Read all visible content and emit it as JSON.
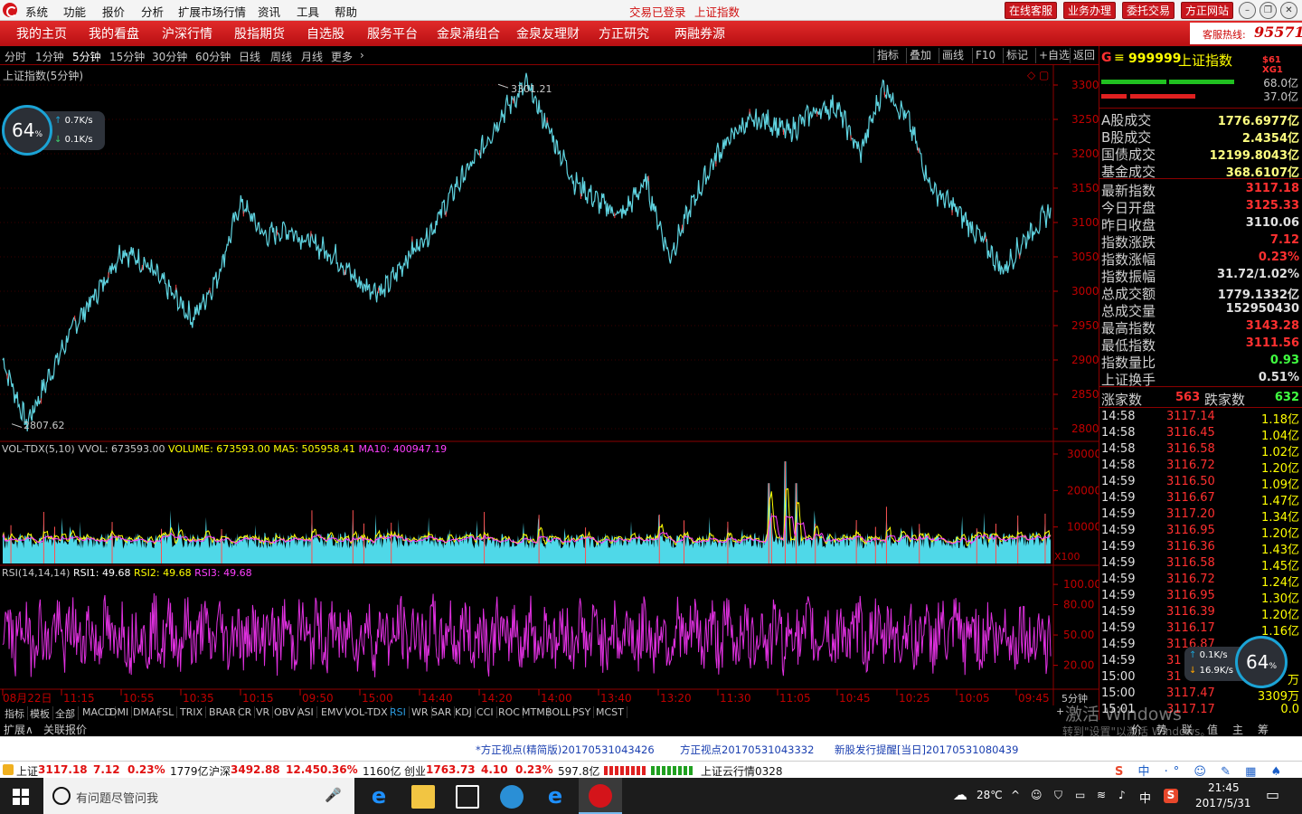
{
  "menu": {
    "items": [
      "系统",
      "功能",
      "报价",
      "分析",
      "扩展市场行情",
      "资讯",
      "工具",
      "帮助"
    ],
    "center": [
      "交易已登录",
      "上证指数"
    ],
    "buttons": [
      "在线客服",
      "业务办理",
      "委托交易",
      "方正网站"
    ]
  },
  "nav": {
    "items": [
      "我的主页",
      "我的看盘",
      "沪深行情",
      "股指期货",
      "自选股",
      "服务平台",
      "金泉涌组合",
      "金泉友理财",
      "方正研究",
      "两融券源"
    ],
    "hotline_label": "客服热线:",
    "hotline_num": "95571"
  },
  "periods": {
    "items": [
      "分时",
      "1分钟",
      "5分钟",
      "15分钟",
      "30分钟",
      "60分钟",
      "日线",
      "周线",
      "月线",
      "更多"
    ],
    "active": 2
  },
  "toolbar": {
    "items": [
      "指标",
      "叠加",
      "画线",
      "F10",
      "标记",
      "+自选",
      "返回"
    ]
  },
  "chart": {
    "title": "上证指数(5分钟)",
    "high_label": "3301.21",
    "low_label": "2807.62",
    "vol_header": {
      "name": "VOL-TDX(5,10)",
      "vvol": "VVOL: 673593.00",
      "volume": "VOLUME: 673593.00",
      "ma5": "MA5: 505958.41",
      "ma10": "MA10: 400947.19"
    },
    "vol_unit": "X100",
    "rsi_header": {
      "name": "RSI(14,14,14)",
      "rsi1": "RSI1: 49.68",
      "rsi2": "RSI2: 49.68",
      "rsi3": "RSI3: 49.68"
    },
    "x_labels": [
      "08月22日",
      "11:15",
      "10:55",
      "10:35",
      "10:15",
      "09:50",
      "15:00",
      "14:40",
      "14:20",
      "14:00",
      "13:40",
      "13:20",
      "11:30",
      "11:05",
      "10:45",
      "10:25",
      "10:05",
      "09:45"
    ],
    "x_unit": "5分钟",
    "colors": {
      "price": "#5fd3e0",
      "price_up": "#ff4040",
      "vol": "#4fd8e8",
      "ma5": "#ffff00",
      "ma10": "#ff40ff",
      "rsi": "#e030e0",
      "grid": "#8b0000",
      "axis": "#c00000"
    }
  },
  "chart_data": {
    "type": "line",
    "title": "上证指数(5分钟)",
    "ylim": [
      2800,
      3300
    ],
    "yticks": [
      3300,
      3250,
      3200,
      3150,
      3100,
      3050,
      3000,
      2950,
      2900,
      2850,
      2800
    ],
    "x": [
      "08月22日",
      "11:15",
      "10:55",
      "10:35",
      "10:15",
      "09:50",
      "15:00",
      "14:40",
      "14:20",
      "14:00",
      "13:40",
      "13:20",
      "11:30",
      "11:05",
      "10:45",
      "10:25",
      "10:05",
      "09:45"
    ],
    "series": [
      {
        "values": [
          2900,
          2807,
          2880,
          2950,
          3000,
          3060,
          3040,
          3000,
          2960,
          3020,
          3130,
          3080,
          3090,
          3070,
          3050,
          3010,
          3000,
          3050,
          3090,
          3150,
          3200,
          3260,
          3301,
          3230,
          3160,
          3130,
          3110,
          3160,
          3050,
          3130,
          3200,
          3240,
          3250,
          3230,
          3260,
          3270,
          3200,
          3300,
          3250,
          3150,
          3120,
          3080,
          3030,
          3080,
          3117
        ]
      }
    ],
    "vol": {
      "ylim": [
        0,
        30000
      ],
      "yticks": [
        30000,
        20000,
        10000
      ]
    },
    "rsi": {
      "ylim": [
        0,
        100
      ],
      "yticks": [
        100.0,
        80.0,
        50.0,
        20.0
      ],
      "last": 49.68
    }
  },
  "speed": {
    "pct": "64",
    "pct_unit": "%",
    "up": "0.7K/s",
    "down": "0.1K/s",
    "up2": "0.1K/s",
    "down2": "16.9K/s"
  },
  "rpanel": {
    "header": {
      "code": "999999",
      "name": "上证指数",
      "tag": "$61 XG1",
      "pct1": "68.0亿",
      "pct2": "37.0亿"
    },
    "volumes": [
      [
        "A股成交",
        "1776.6977亿"
      ],
      [
        "B股成交",
        "2.4354亿"
      ],
      [
        "国债成交",
        "12199.8043亿"
      ],
      [
        "基金成交",
        "368.6107亿"
      ]
    ],
    "stats": [
      [
        "最新指数",
        "3117.18",
        "#ff3030"
      ],
      [
        "今日开盘",
        "3125.33",
        "#ff3030"
      ],
      [
        "昨日收盘",
        "3110.06",
        "#e0e0e0"
      ],
      [
        "指数涨跌",
        "7.12",
        "#ff3030"
      ],
      [
        "指数涨幅",
        "0.23%",
        "#ff3030"
      ],
      [
        "指数振幅",
        "31.72/1.02%",
        "#e0e0e0"
      ],
      [
        "总成交额",
        "1779.1332亿",
        "#e0e0e0"
      ],
      [
        "总成交量",
        "152950430",
        "#e0e0e0"
      ],
      [
        "最高指数",
        "3143.28",
        "#ff3030"
      ],
      [
        "最低指数",
        "3111.56",
        "#ff3030"
      ],
      [
        "指数量比",
        "0.93",
        "#40ff40"
      ],
      [
        "上证换手",
        "0.51%",
        "#e0e0e0"
      ]
    ],
    "updown": {
      "up_label": "涨家数",
      "up": "563",
      "down_label": "跌家数",
      "down": "632"
    },
    "ticks": [
      [
        "14:58",
        "3117.14",
        "1.18亿"
      ],
      [
        "14:58",
        "3116.45",
        "1.04亿"
      ],
      [
        "14:58",
        "3116.58",
        "1.02亿"
      ],
      [
        "14:58",
        "3116.72",
        "1.20亿"
      ],
      [
        "14:59",
        "3116.50",
        "1.09亿"
      ],
      [
        "14:59",
        "3116.67",
        "1.47亿"
      ],
      [
        "14:59",
        "3117.20",
        "1.34亿"
      ],
      [
        "14:59",
        "3116.95",
        "1.20亿"
      ],
      [
        "14:59",
        "3116.36",
        "1.43亿"
      ],
      [
        "14:59",
        "3116.58",
        "1.45亿"
      ],
      [
        "14:59",
        "3116.72",
        "1.24亿"
      ],
      [
        "14:59",
        "3116.95",
        "1.30亿"
      ],
      [
        "14:59",
        "3116.39",
        "1.20亿"
      ],
      [
        "14:59",
        "3116.17",
        "1.16亿"
      ],
      [
        "14:59",
        "3116.87",
        ""
      ],
      [
        "14:59",
        "31",
        ""
      ],
      [
        "15:00",
        "31",
        "万"
      ],
      [
        "15:00",
        "3117.47",
        "3309万"
      ],
      [
        "15:01",
        "3117.17",
        "0.0"
      ]
    ],
    "bottom_tabs": [
      "价",
      "势",
      "联",
      "值",
      "主",
      "筹"
    ]
  },
  "tabs": {
    "items": [
      "指标",
      "模板",
      "全部",
      "MACD",
      "DMI",
      "DMA",
      "FSL",
      "TRIX",
      "BRAR",
      "CR",
      "VR",
      "OBV",
      "ASI",
      "EMV",
      "VOL-TDX",
      "RSI",
      "WR",
      "SAR",
      "KDJ",
      "CCI",
      "ROC",
      "MTM",
      "BOLL",
      "PSY",
      "MCST"
    ],
    "active": 15,
    "row2": [
      "扩展∧",
      "关联报价"
    ]
  },
  "news": [
    "*方正视点(精简版)20170531043426",
    "方正视点20170531043332",
    "新股发行提醒[当日]20170531080439"
  ],
  "status": [
    {
      "name": "上证",
      "val": "3117.18",
      "chg": "7.12",
      "pct": "0.23%",
      "amt": "1779亿"
    },
    {
      "name": "沪深",
      "val": "3492.88",
      "chg": "12.45",
      "pct": "0.36%",
      "amt": "1160亿"
    },
    {
      "name": "创业",
      "val": "1763.73",
      "chg": "4.10",
      "pct": "0.23%",
      "amt": "597.8亿"
    }
  ],
  "status_right": "上证云行情0328",
  "watermark": {
    "line1": "激活 Windows",
    "line2": "转到\"设置\"以激活 Windows。"
  },
  "taskbar": {
    "search": "有问题尽管问我",
    "temp": "28℃",
    "ime": "中",
    "time": "21:45",
    "date": "2017/5/31"
  }
}
